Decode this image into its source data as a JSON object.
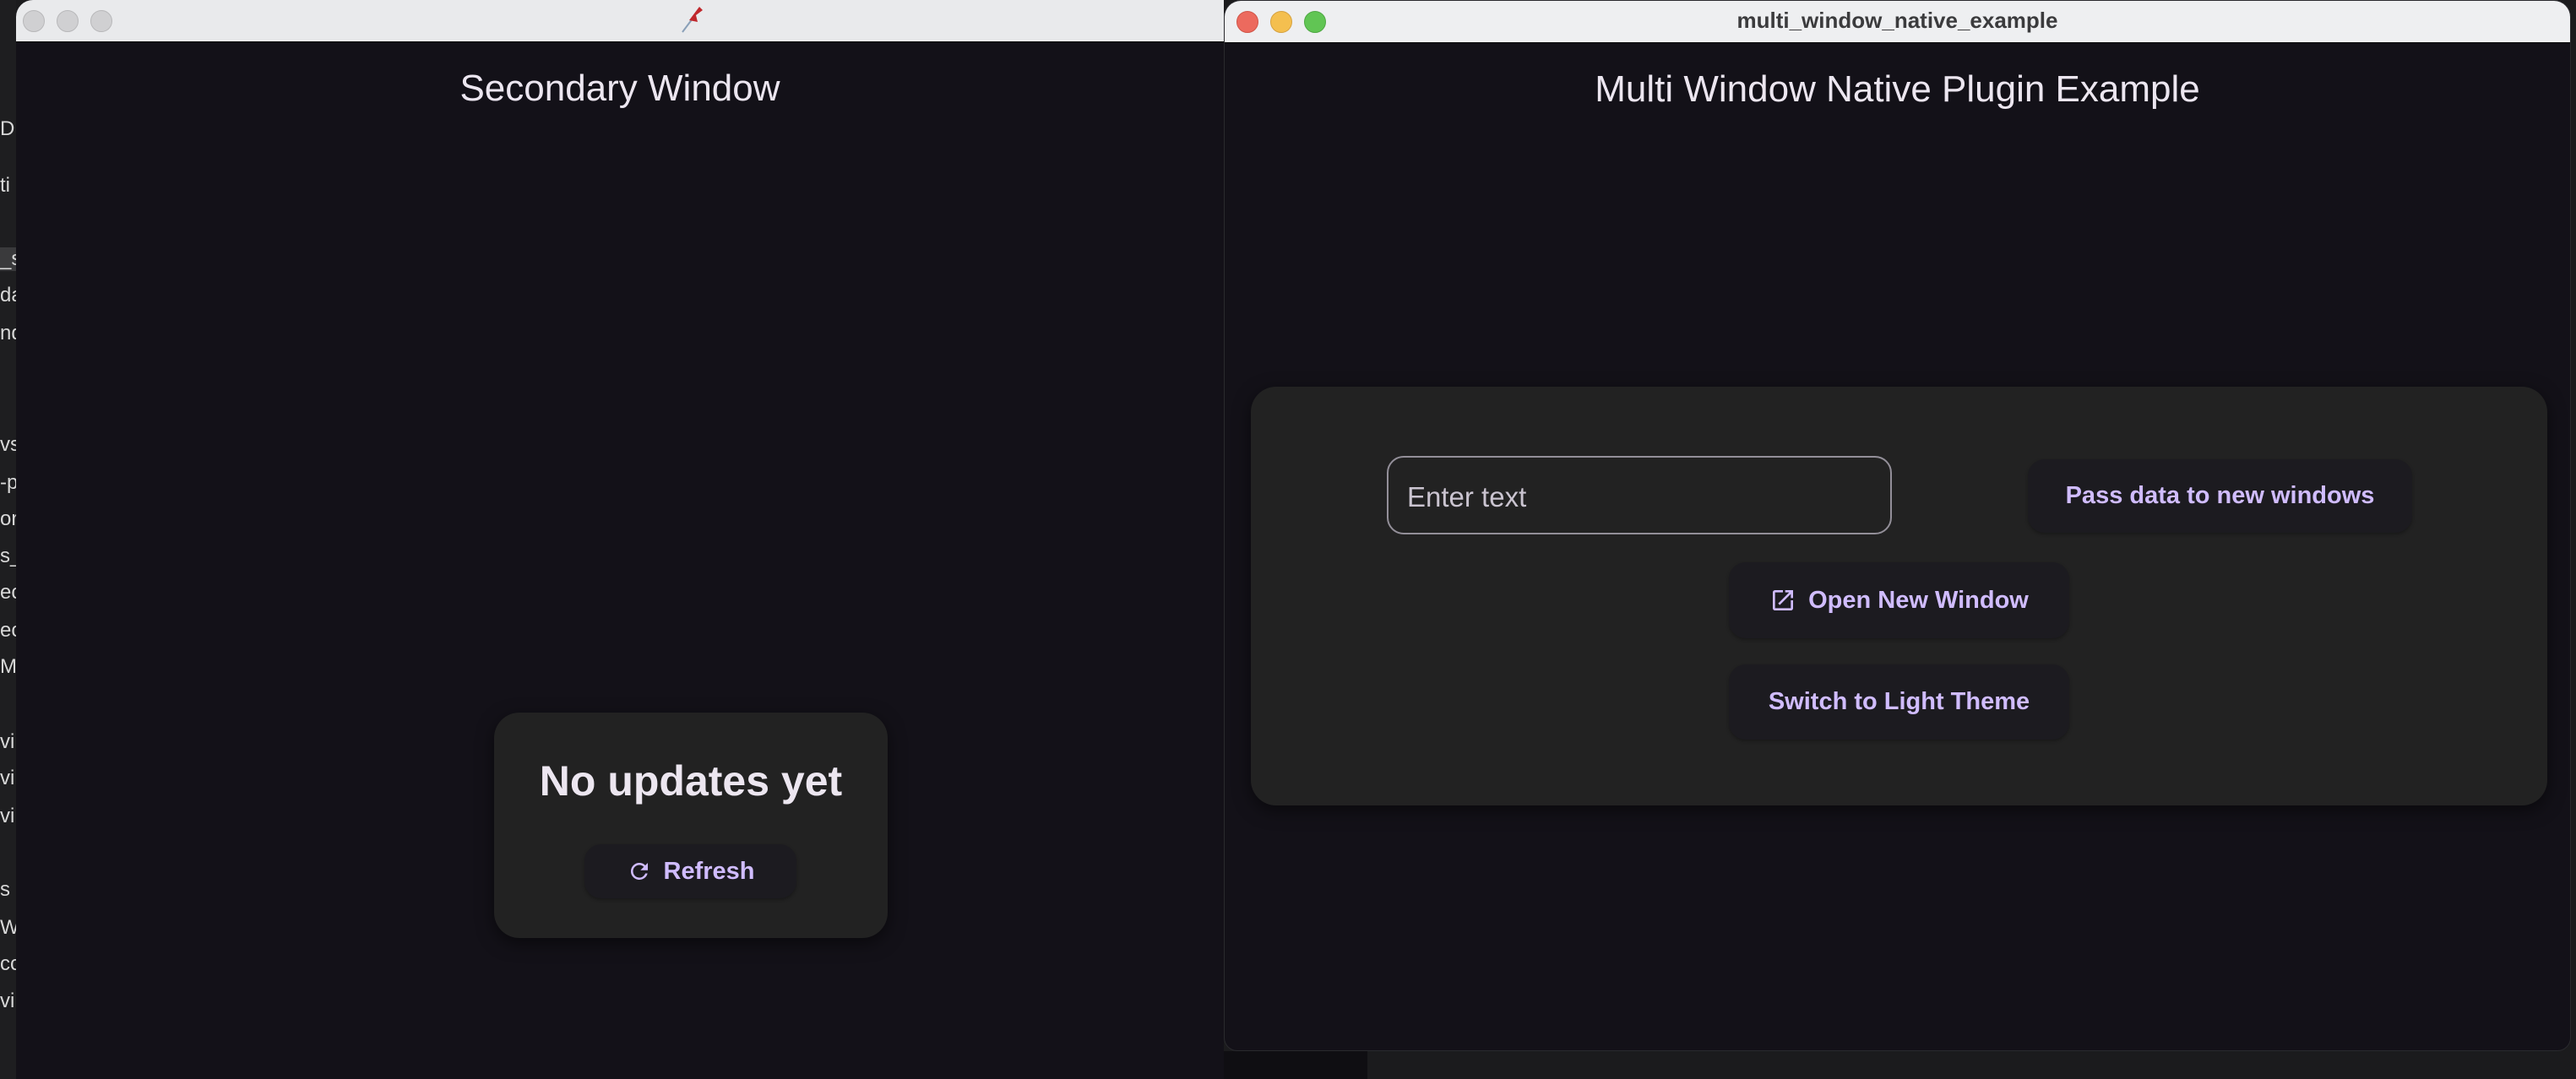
{
  "sidebar_fragments": [
    "D",
    "ti",
    "_s",
    "da",
    "nd",
    "vs",
    "-p",
    "or",
    "s_",
    "ec",
    "ec",
    "ME",
    "vi",
    "vi",
    "vi",
    "s",
    "W",
    "cc",
    "vi"
  ],
  "secondary_window": {
    "heading": "Secondary Window",
    "status_text": "No updates yet",
    "refresh_label": "Refresh",
    "titlebar_icon": "pushpin-icon"
  },
  "main_window": {
    "title": "multi_window_native_example",
    "heading": "Multi Window Native Plugin Example",
    "input_placeholder": "Enter text",
    "pass_data_label": "Pass data to new windows",
    "open_window_label": "Open New Window",
    "theme_label": "Switch to Light Theme"
  },
  "colors": {
    "accent": "#d0bcff",
    "background": "#131118",
    "card": "#222222"
  }
}
